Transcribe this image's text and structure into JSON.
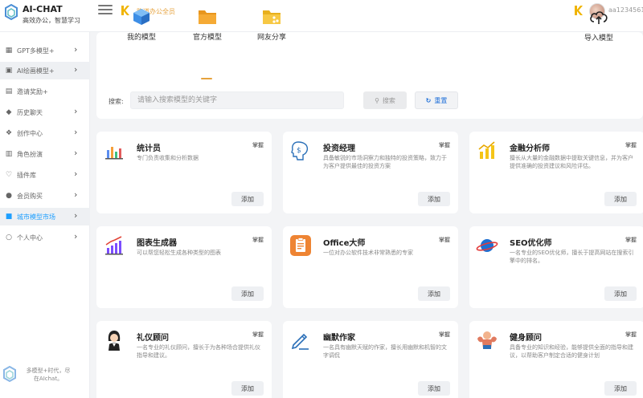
{
  "header": {
    "app_title": "AI-CHAT",
    "app_subtitle": "高效办公，智慧学习",
    "home_link": "跑道办公全员",
    "username": "aa1234561"
  },
  "sidebar": {
    "items": [
      {
        "label": "GPT多模型+",
        "icon": "grid-icon"
      },
      {
        "label": "AI绘画模型+",
        "icon": "image-icon"
      },
      {
        "label": "邀请奖励+",
        "icon": "gift-icon"
      },
      {
        "label": "历史聊天",
        "icon": "tag-icon"
      },
      {
        "label": "创作中心",
        "icon": "cube-icon"
      },
      {
        "label": "角色扮演",
        "icon": "book-icon"
      },
      {
        "label": "插件库",
        "icon": "heart-icon"
      },
      {
        "label": "会员购买",
        "icon": "user-icon"
      },
      {
        "label": "城市模型市场",
        "icon": "shop-icon"
      },
      {
        "label": "个人中心",
        "icon": "person-icon"
      }
    ],
    "footer_text": "多模型+时代，尽在AIchat。"
  },
  "tabs": [
    {
      "label": "我的模型",
      "icon": "cube-icon"
    },
    {
      "label": "官方模型",
      "icon": "folder-icon"
    },
    {
      "label": "网友分享",
      "icon": "share-folder-icon"
    }
  ],
  "import_label": "导入模型",
  "search": {
    "label": "搜索:",
    "placeholder": "请输入搜索模型的关键字",
    "search_button": "搜索",
    "reset_button": "重置"
  },
  "cards": [
    {
      "name": "统计员",
      "tag": "掌握",
      "desc": "专门负责收集和分析数据",
      "add": "添加",
      "icon": "bar-chart-icon"
    },
    {
      "name": "投资经理",
      "tag": "掌握",
      "desc": "具备敏锐的市场洞察力和独特的投资策略，致力于为客户提供最佳的投资方案",
      "add": "添加",
      "icon": "investment-icon"
    },
    {
      "name": "金融分析师",
      "tag": "掌握",
      "desc": "擅长从大量的金融数据中提取关键信息，并为客户提供准确的投资建议和风险评估。",
      "add": "添加",
      "icon": "finance-chart-icon"
    },
    {
      "name": "图表生成器",
      "tag": "掌握",
      "desc": "可以帮您轻松生成各种类型的图表",
      "add": "添加",
      "icon": "chart-generator-icon"
    },
    {
      "name": "Office大师",
      "tag": "掌握",
      "desc": "一位对办公软件技术非常熟悉的专家",
      "add": "添加",
      "icon": "office-icon"
    },
    {
      "name": "SEO优化师",
      "tag": "掌握",
      "desc": "一名专业的SEO优化师，擅长于提高网站在搜索引擎中的排名。",
      "add": "添加",
      "icon": "planet-icon"
    },
    {
      "name": "礼仪顾问",
      "tag": "掌握",
      "desc": "一名专业的礼仪顾问，擅长于为各种场合提供礼仪指导和建议。",
      "add": "添加",
      "icon": "etiquette-woman-icon"
    },
    {
      "name": "幽默作家",
      "tag": "掌握",
      "desc": "一名具有幽默天赋的作家，擅长用幽默和机智的文字调侃",
      "add": "添加",
      "icon": "pen-icon"
    },
    {
      "name": "健身顾问",
      "tag": "掌握",
      "desc": "具备专业的知识和经验，能够提供全面的指导和建议，以帮助客户制定合适的健身计划",
      "add": "添加",
      "icon": "muscle-icon"
    }
  ]
}
